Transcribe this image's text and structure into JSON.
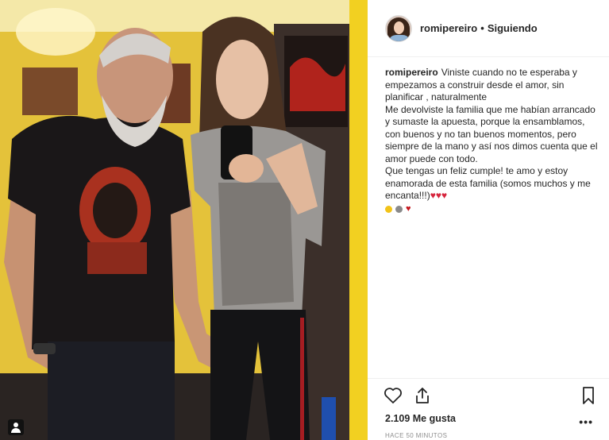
{
  "post": {
    "username": "romipereiro",
    "separator": "•",
    "follow_status": "Siguiendo"
  },
  "caption": {
    "username": "romipereiro",
    "lines": [
      "Viniste cuando no te esperaba y empezamos a construir desde el amor, sin planificar , naturalmente",
      "Me devolviste la familia que me habían arrancado y sumaste la apuesta, porque la ensamblamos, con buenos y no tan buenos momentos, pero siempre de la mano y así nos dimos cuenta que el amor puede con todo.",
      "Que tengas un feliz cumple! te amo y estoy enamorada de esta familia (somos muchos y me encanta!!!)"
    ],
    "inline_hearts": "♥♥♥",
    "emoji_row": [
      {
        "kind": "circle",
        "color": "#f2c318"
      },
      {
        "kind": "circle",
        "color": "#8a8a8a"
      },
      {
        "kind": "heart",
        "color": "#c4161c"
      }
    ]
  },
  "actions": {
    "like_icon": "heart-outline-icon",
    "share_icon": "share-upload-icon",
    "save_icon": "bookmark-icon",
    "more_icon": "more-dots-icon",
    "more_label": "•••"
  },
  "likes_text": "2.109 Me gusta",
  "timestamp": "HACE 50 MINUTOS",
  "colors": {
    "text": "#262626",
    "secondary": "#8e8e8e",
    "border": "#efefef",
    "photo_wall": "#e9c832"
  }
}
